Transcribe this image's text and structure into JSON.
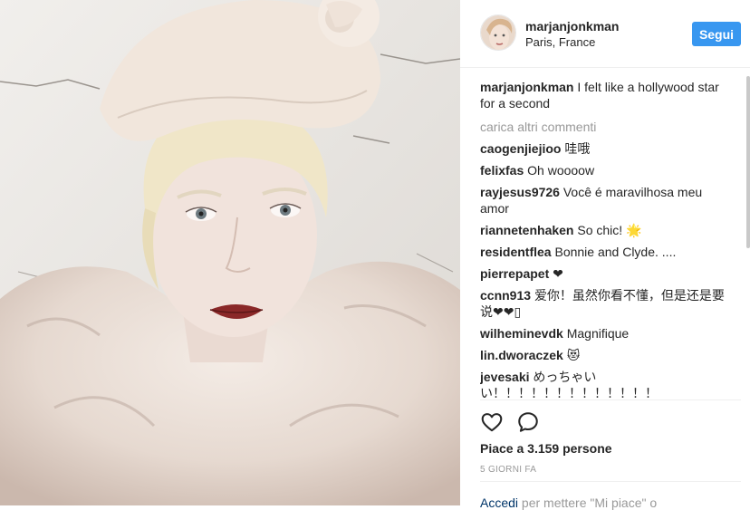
{
  "post": {
    "username": "marjanjonkman",
    "location": "Paris, France",
    "follow_label": "Segui"
  },
  "caption": {
    "username": "marjanjonkman",
    "text": "I felt like a hollywood star for a second"
  },
  "load_more_label": "carica altri commenti",
  "comments": [
    {
      "user": "caogenjiejioo",
      "text": "哇哦"
    },
    {
      "user": "felixfas",
      "text": "Oh woooow"
    },
    {
      "user": "rayjesus9726",
      "text": "Você é maravilhosa meu amor"
    },
    {
      "user": "riannetenhaken",
      "text": "So chic! 🌟"
    },
    {
      "user": "residentflea",
      "text": "Bonnie and Clyde. ...."
    },
    {
      "user": "pierrepapet",
      "text": "❤"
    },
    {
      "user": "ccnn913",
      "text": "爱你！虽然你看不懂，但是还是要说❤❤▯"
    },
    {
      "user": "wilheminevdk",
      "text": "Magnifique"
    },
    {
      "user": "lin.dworaczek",
      "text": "😻"
    },
    {
      "user": "jevesaki",
      "text": "めっちゃいい！！！！！！！！！！！！！"
    }
  ],
  "actions": {
    "like_icon": "heart-outline",
    "comment_icon": "speech-bubble"
  },
  "likes_text": "Piace a 3.159 persone",
  "timestamp": "5 GIORNI FA",
  "login": {
    "link": "Accedi",
    "rest": " per mettere \"Mi piace\" o"
  }
}
